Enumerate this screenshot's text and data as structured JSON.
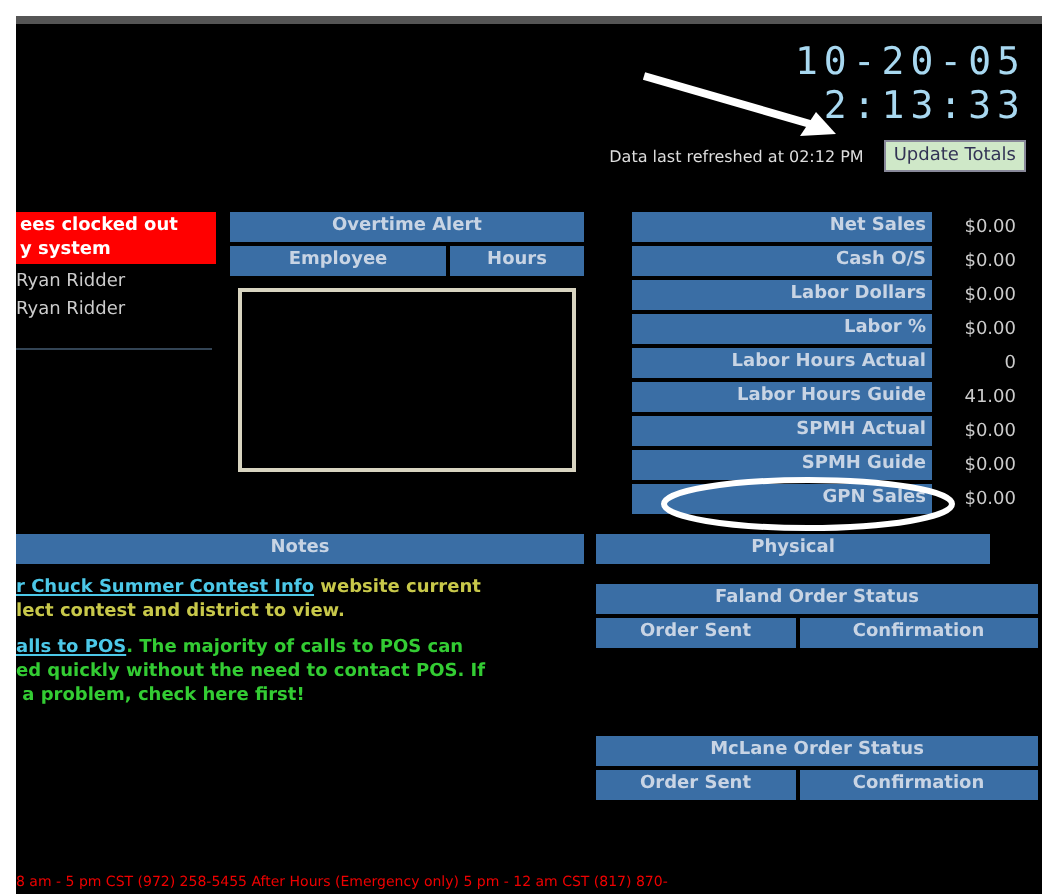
{
  "clock": {
    "date": "10-20-05",
    "time": "2:13:33"
  },
  "refresh": {
    "text": "Data last refreshed at 02:12 PM",
    "button": "Update Totals"
  },
  "clocked_out": {
    "title_lines": [
      "ees clocked out",
      "y system"
    ],
    "names": [
      "Ryan Ridder",
      "Ryan Ridder"
    ]
  },
  "overtime_alert": {
    "title": "Overtime Alert",
    "columns": [
      "Employee",
      "Hours"
    ]
  },
  "metrics": [
    {
      "label": "Net Sales",
      "value": "$0.00"
    },
    {
      "label": "Cash O/S",
      "value": "$0.00"
    },
    {
      "label": "Labor Dollars",
      "value": "$0.00"
    },
    {
      "label": "Labor %",
      "value": "$0.00"
    },
    {
      "label": "Labor Hours Actual",
      "value": "0"
    },
    {
      "label": "Labor Hours Guide",
      "value": "41.00"
    },
    {
      "label": "SPMH Actual",
      "value": "$0.00"
    },
    {
      "label": "SPMH Guide",
      "value": "$0.00"
    },
    {
      "label": "GPN Sales",
      "value": "$0.00"
    }
  ],
  "notes": {
    "title": "Notes",
    "items": [
      {
        "link": "r Chuck Summer Contest Info",
        "color": "#c8c84a",
        "lines": [
          " website current",
          "lect contest and district to view."
        ]
      },
      {
        "link": "alls to POS",
        "color": "#33cc33",
        "lines": [
          ". The majority of calls to POS can",
          "ed quickly without the need to contact POS. If",
          " a problem, check here first!"
        ]
      }
    ]
  },
  "physical_button": "Physical",
  "order_tables": [
    {
      "title": "Faland Order Status",
      "columns": [
        "Order Sent",
        "Confirmation"
      ]
    },
    {
      "title": "McLane Order Status",
      "columns": [
        "Order Sent",
        "Confirmation"
      ]
    }
  ],
  "footer": "8 am - 5 pm CST  (972) 258-5455   After Hours (Emergency only) 5 pm - 12 am CST (817) 870-"
}
